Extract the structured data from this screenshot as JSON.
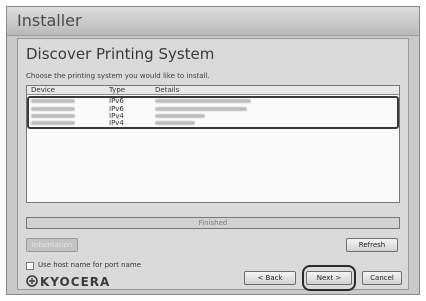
{
  "window": {
    "title": "Installer"
  },
  "page": {
    "heading": "Discover Printing System",
    "instruction": "Choose the printing system you would like to install."
  },
  "device_list": {
    "columns": [
      "Device",
      "Type",
      "Details"
    ],
    "rows": [
      {
        "type": "IPv6"
      },
      {
        "type": "IPv6"
      },
      {
        "type": "IPv4"
      },
      {
        "type": "IPv4"
      }
    ]
  },
  "status": {
    "text": "Finished"
  },
  "buttons": {
    "information": "Information",
    "refresh": "Refresh",
    "back": "< Back",
    "next": "Next >",
    "cancel": "Cancel"
  },
  "options": {
    "use_host_name_label": "Use host name for port name"
  },
  "brand": {
    "name": "KYOCERA",
    "logo_icon": "kyocera-logo-icon"
  }
}
